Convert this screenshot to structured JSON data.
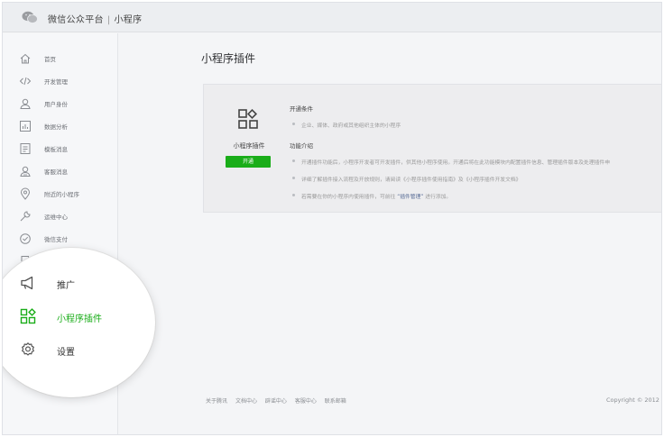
{
  "header": {
    "brand": "微信公众平台",
    "section": "小程序"
  },
  "sidebar": {
    "items": [
      {
        "label": "首页",
        "icon": "home-icon"
      },
      {
        "label": "开发管理",
        "icon": "code-icon"
      },
      {
        "label": "用户身份",
        "icon": "user-icon"
      },
      {
        "label": "数据分析",
        "icon": "chart-icon"
      },
      {
        "label": "模板消息",
        "icon": "message-icon"
      },
      {
        "label": "客服消息",
        "icon": "service-icon"
      },
      {
        "label": "附近的小程序",
        "icon": "location-icon"
      },
      {
        "label": "运维中心",
        "icon": "wrench-icon"
      },
      {
        "label": "微信支付",
        "icon": "pay-icon"
      }
    ]
  },
  "magnifier": {
    "items": [
      {
        "label": "推广",
        "icon": "megaphone-icon"
      },
      {
        "label": "小程序插件",
        "icon": "plugin-icon",
        "active": true
      },
      {
        "label": "设置",
        "icon": "settings-icon"
      }
    ],
    "active_color": "#1aad19"
  },
  "main": {
    "heading": "小程序插件",
    "plugin": {
      "name": "小程序插件",
      "open_button": "开通"
    },
    "conditions_title": "开通条件",
    "conditions": [
      "企业、媒体、政府或其他组织主体的小程序"
    ],
    "features_title": "功能介绍",
    "features": [
      {
        "text": "开通插件功能后，小程序开发者可开发插件，供其他小程序使用。开通后将在此功能模块内配置插件信息、管理插件版本及处理插件申"
      },
      {
        "text": "详细了解插件接入流程及开放规则，请阅读《小程序插件使用指南》及《小程序插件开发文档》"
      },
      {
        "before": "若需要在你的小程序内使用插件，可前往 ",
        "link": "“插件管理”",
        "after": " 进行添加。"
      }
    ]
  },
  "footer": {
    "links": [
      "关于腾讯",
      "文档中心",
      "辟谣中心",
      "客服中心",
      "联系邮箱"
    ],
    "copyright": "Copyright © 2012"
  },
  "colors": {
    "brand_green": "#1aad19",
    "link": "#576b95"
  }
}
